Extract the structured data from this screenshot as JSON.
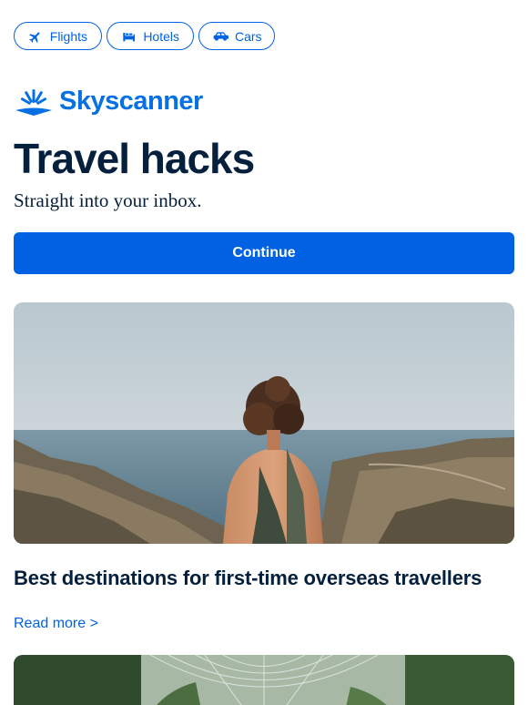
{
  "nav": {
    "items": [
      {
        "label": "Flights",
        "icon": "plane-icon"
      },
      {
        "label": "Hotels",
        "icon": "bed-icon"
      },
      {
        "label": "Cars",
        "icon": "car-icon"
      }
    ]
  },
  "brand": {
    "name": "Skyscanner",
    "color": "#0770e3"
  },
  "hero": {
    "title": "Travel hacks",
    "subtitle": "Straight into your inbox.",
    "cta_label": "Continue"
  },
  "article": {
    "title": "Best destinations for first-time overseas travellers",
    "link_label": "Read more >"
  },
  "colors": {
    "primary": "#0062e3",
    "text": "#05203c"
  }
}
